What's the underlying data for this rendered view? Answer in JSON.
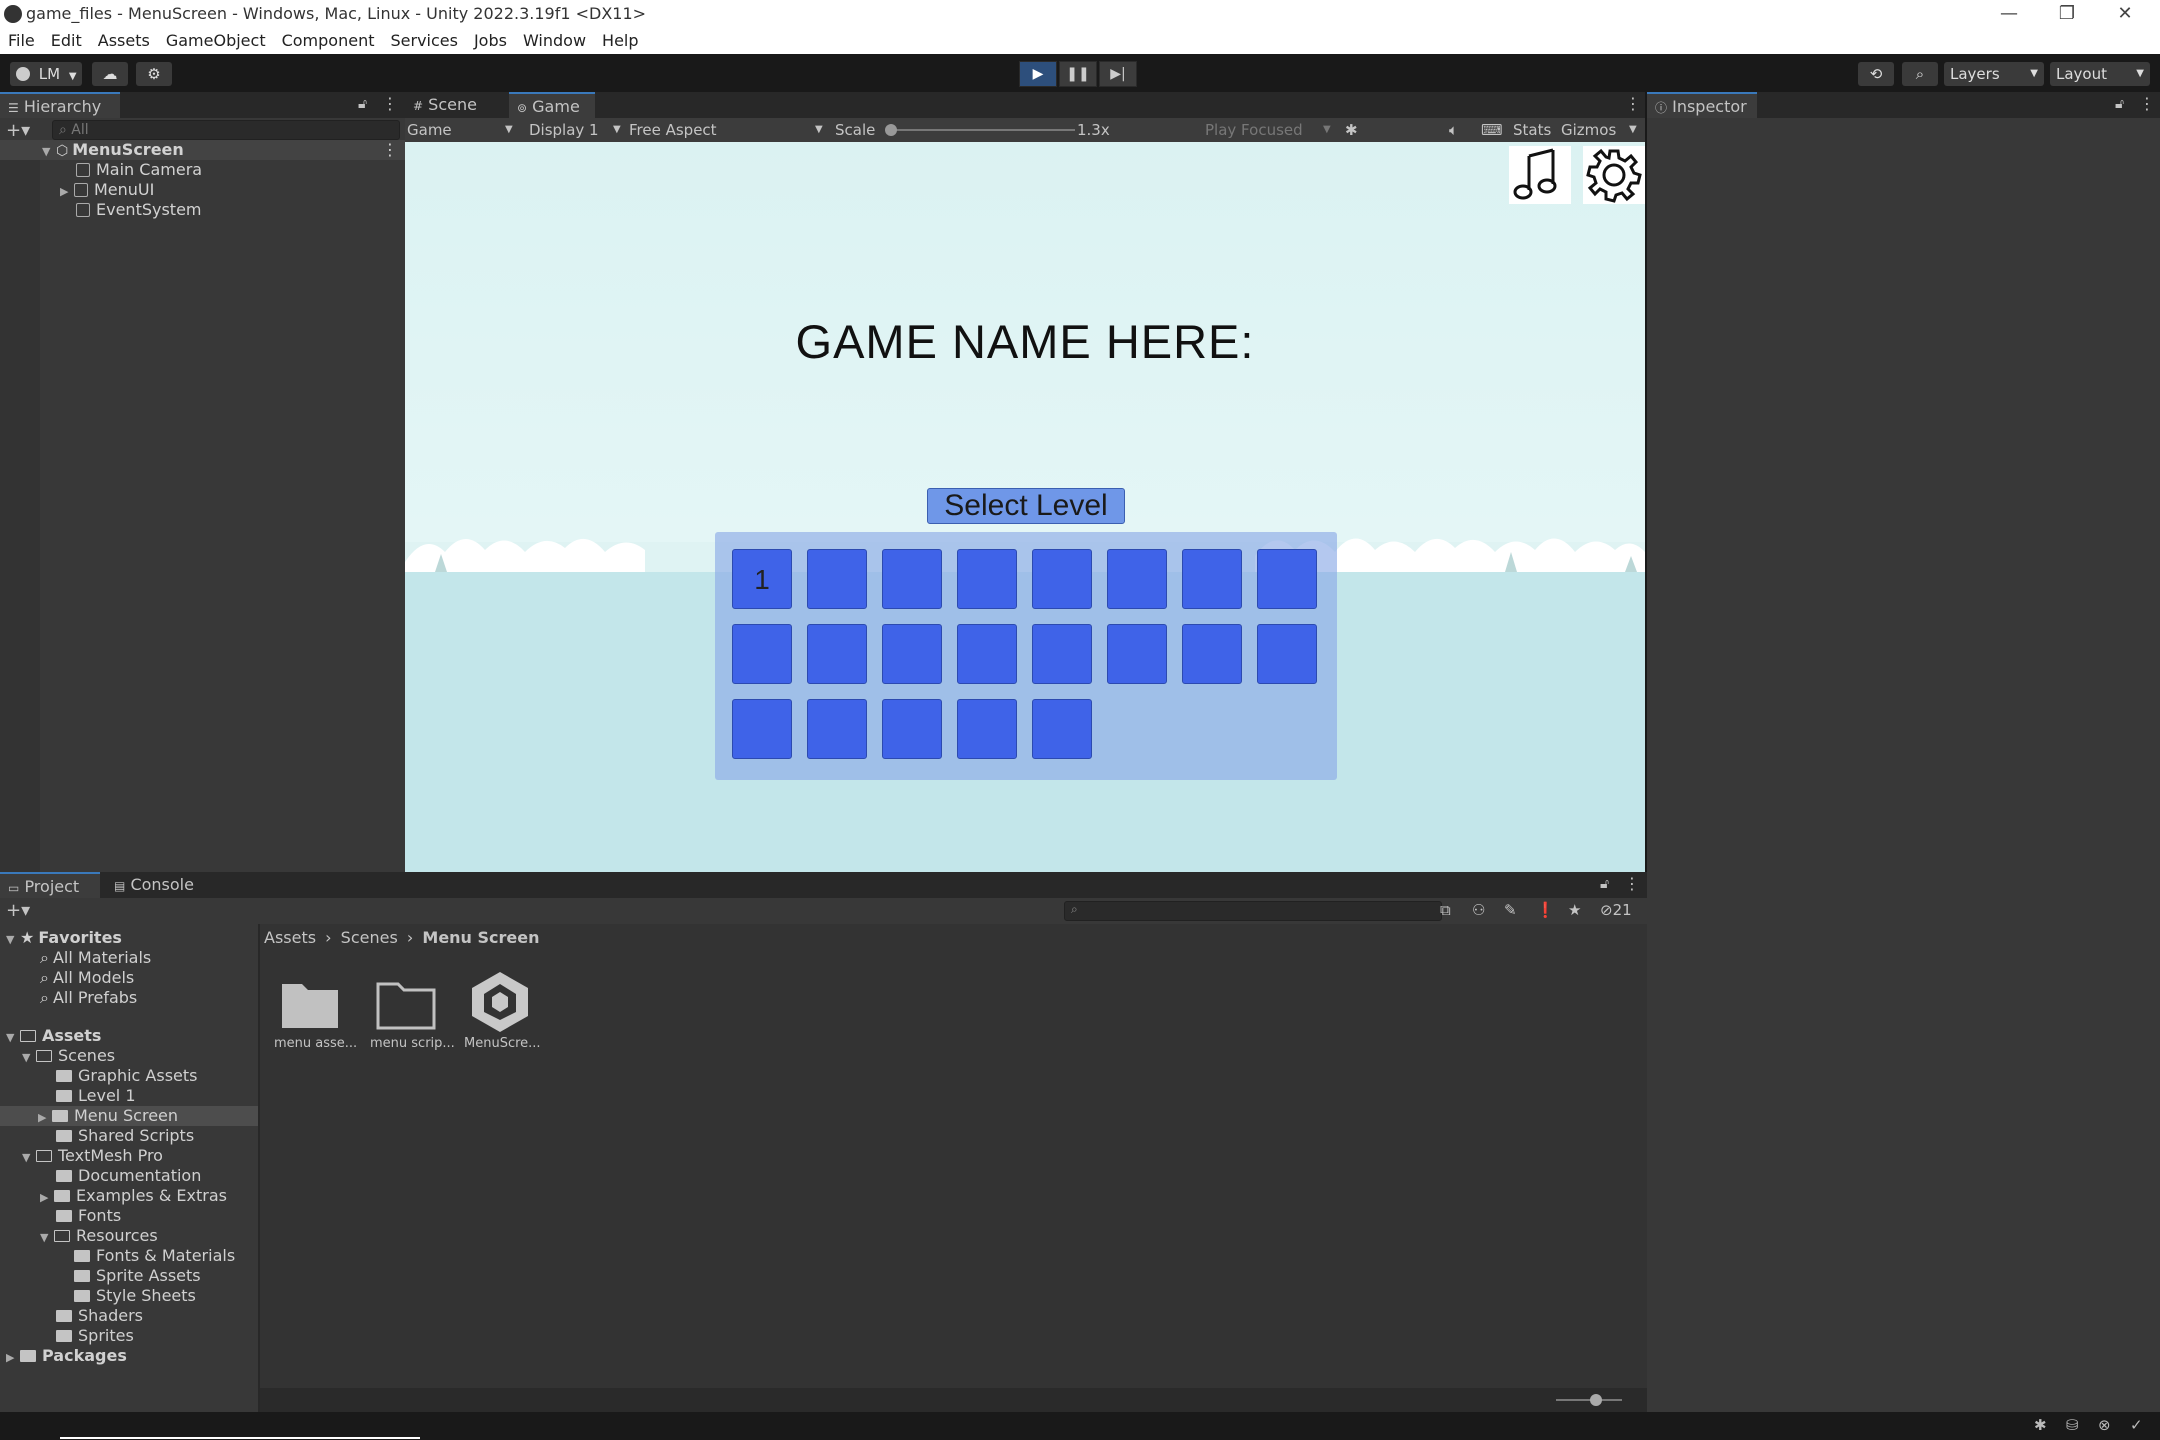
{
  "window": {
    "title": "game_files - MenuScreen - Windows, Mac, Linux - Unity 2022.3.19f1 <DX11>",
    "minimize": "—",
    "restore": "❐",
    "close": "✕"
  },
  "menu": [
    "File",
    "Edit",
    "Assets",
    "GameObject",
    "Component",
    "Services",
    "Jobs",
    "Window",
    "Help"
  ],
  "toolbar": {
    "account": "LM",
    "layers": "Layers",
    "layout": "Layout"
  },
  "hierarchy": {
    "tab": "Hierarchy",
    "search_placeholder": "All",
    "scene": "MenuScreen",
    "items": [
      "Main Camera",
      "MenuUI",
      "EventSystem"
    ]
  },
  "scene_tabs": {
    "scene": "Scene",
    "game": "Game"
  },
  "game_bar": {
    "mode": "Game",
    "display": "Display 1",
    "aspect": "Free Aspect",
    "scale_label": "Scale",
    "scale_value": "1.3x",
    "play_focused": "Play Focused",
    "stats": "Stats",
    "gizmos": "Gizmos"
  },
  "game": {
    "title": "GAME NAME HERE:",
    "select_level": "Select Level",
    "first_level": "1"
  },
  "inspector": {
    "tab": "Inspector"
  },
  "project": {
    "tab_project": "Project",
    "tab_console": "Console",
    "hidden_count": "21",
    "breadcrumb": [
      "Assets",
      "Scenes",
      "Menu Screen"
    ],
    "favorites": {
      "label": "Favorites",
      "items": [
        "All Materials",
        "All Models",
        "All Prefabs"
      ]
    },
    "assets_label": "Assets",
    "tree": {
      "scenes": "Scenes",
      "graphic_assets": "Graphic Assets",
      "level1": "Level 1",
      "menu_screen": "Menu Screen",
      "shared_scripts": "Shared Scripts",
      "textmesh": "TextMesh Pro",
      "documentation": "Documentation",
      "examples": "Examples & Extras",
      "fonts": "Fonts",
      "resources": "Resources",
      "fonts_materials": "Fonts & Materials",
      "sprite_assets": "Sprite Assets",
      "style_sheets": "Style Sheets",
      "shaders": "Shaders",
      "sprites": "Sprites",
      "packages": "Packages"
    },
    "files": [
      "menu asse...",
      "menu scrip...",
      "MenuScre..."
    ]
  }
}
